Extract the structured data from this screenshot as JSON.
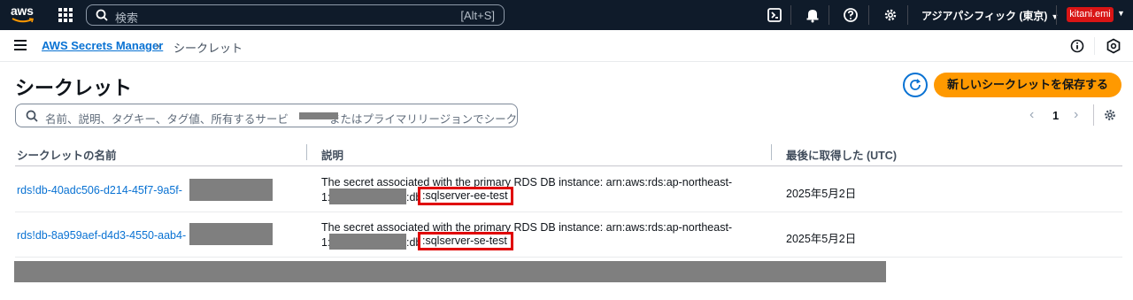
{
  "topnav": {
    "logo_text": "aws",
    "search_placeholder": "検索",
    "search_shortcut": "[Alt+S]",
    "region": "アジアパシフィック (東京)",
    "user": "kitani.emi",
    "icons": [
      "cloudshell-icon",
      "bell-icon",
      "help-icon",
      "gear-icon"
    ]
  },
  "breadcrumb": {
    "service": "AWS Secrets Manager",
    "current": "シークレット"
  },
  "header": {
    "title": "シークレット",
    "primary_button": "新しいシークレットを保存する"
  },
  "filter": {
    "placeholder_before": "名前、説明、タグキー、タグ値、所有するサービ",
    "placeholder_after": "またはプライマリリージョンでシークレ"
  },
  "pagination": {
    "current_page": "1"
  },
  "table": {
    "columns": [
      "シークレットの名前",
      "説明",
      "最後に取得した (UTC)"
    ],
    "rows": [
      {
        "name": "rds!db-40adc506-d214-45f7-9a5f-",
        "desc_line1": "The secret associated with the primary RDS DB instance: arn:aws:rds:ap-northeast-",
        "desc_line2_prefix": "1:",
        "desc_line2_mid": ":db",
        "desc_highlight": ":sqlserver-ee-test",
        "last_retrieved": "2025年5月2日"
      },
      {
        "name": "rds!db-8a959aef-d4d3-4550-aab4-",
        "desc_line1": "The secret associated with the primary RDS DB instance: arn:aws:rds:ap-northeast-",
        "desc_line2_prefix": "1:",
        "desc_line2_mid": ":db",
        "desc_highlight": ":sqlserver-se-test",
        "last_retrieved": "2025年5月2日"
      }
    ]
  },
  "colors": {
    "nav_bg": "#0f1b2a",
    "link": "#0972d3",
    "primary": "#ff9900",
    "highlight_border": "#e00000",
    "redaction": "#7f7f7f"
  }
}
